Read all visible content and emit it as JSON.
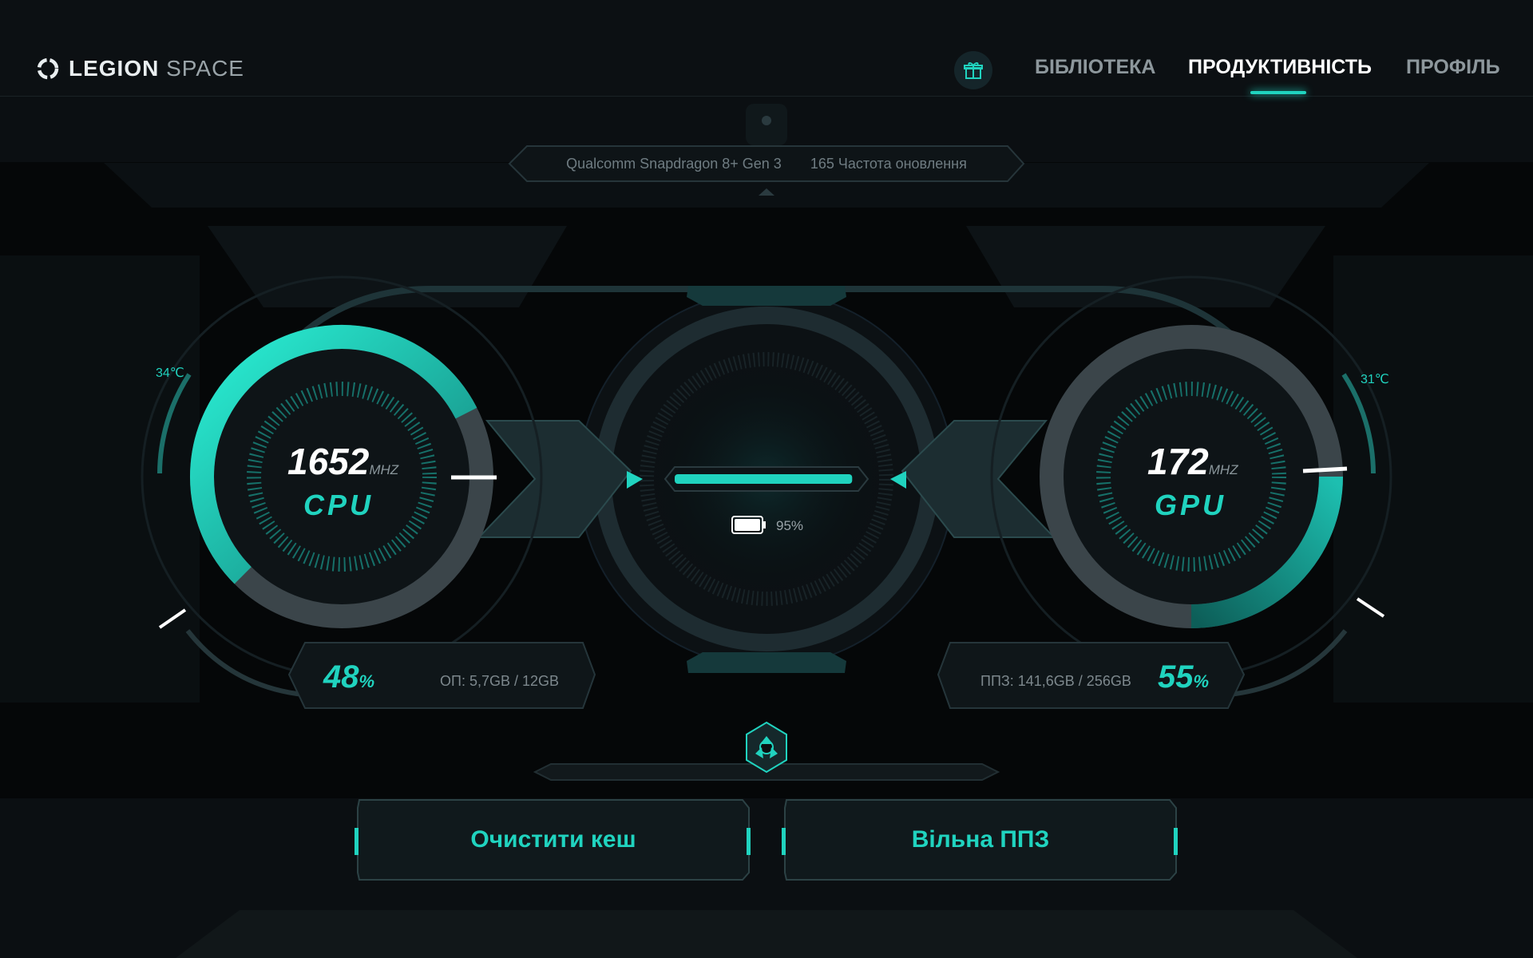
{
  "app": {
    "logo_strong": "LEGION",
    "logo_light": "SPACE"
  },
  "nav": {
    "library": "БІБЛІОТЕКА",
    "performance": "ПРОДУКТИВНІСТЬ",
    "profile": "ПРОФІЛЬ",
    "active": "performance"
  },
  "device": {
    "chip": "Qualcomm Snapdragon 8+ Gen 3",
    "refresh": "165 Частота оновлення"
  },
  "cpu": {
    "freq": "1652",
    "unit": "MHZ",
    "label": "CPU",
    "temp": "34℃",
    "load_pct": "48",
    "pct_sign": "%",
    "memory": "ОП: 5,7GB / 12GB",
    "gauge_fraction": 0.55
  },
  "gpu": {
    "freq": "172",
    "unit": "MHZ",
    "label": "GPU",
    "temp": "31℃",
    "load_pct": "55",
    "pct_sign": "%",
    "storage": "ППЗ: 141,6GB / 256GB",
    "gauge_fraction": 0.25
  },
  "battery": {
    "percent": "95%",
    "level": 0.95
  },
  "actions": {
    "clear_cache": "Очистити кеш",
    "free_storage": "Вільна ППЗ"
  },
  "colors": {
    "accent": "#20d3bf",
    "background": "#0b0f12"
  }
}
